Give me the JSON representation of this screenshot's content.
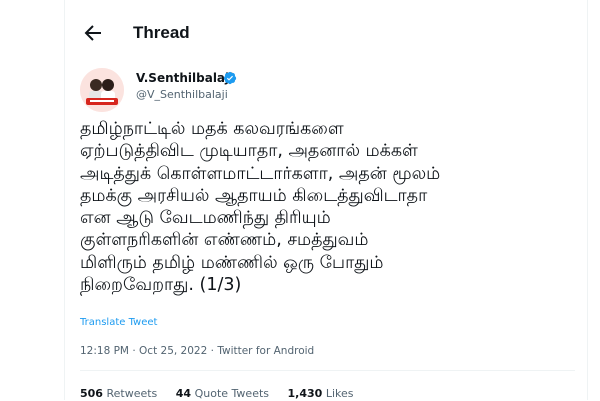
{
  "header": {
    "title": "Thread",
    "back_icon": "arrow-left-icon"
  },
  "tweet": {
    "author": {
      "name": "V.Senthilbalaji",
      "handle": "@V_Senthilbalaji",
      "verified": true,
      "verified_color": "#1d9bf0"
    },
    "text_lines": [
      "தமிழ்நாட்டில் மதக் கலவரங்களை",
      "ஏற்படுத்திவிட முடியாதா, அதனால் மக்கள்",
      "அடித்துக் கொள்ளமாட்டார்களா, அதன் மூலம்",
      "தமக்கு அரசியல் ஆதாயம் கிடைத்துவிடாதா",
      "என ஆடு வேடமணிந்து திரியும்",
      "குள்ளநரிகளின் எண்ணம், சமத்துவம்",
      "மிளிரும் தமிழ் மண்ணில் ஒரு போதும்",
      "நிறைவேறாது. (1/3)"
    ],
    "translate_label": "Translate Tweet",
    "time": "12:18 PM",
    "date": "Oct 25, 2022",
    "source": "Twitter for Android",
    "separator": "·",
    "stats": {
      "retweets": {
        "count": "506",
        "label": "Retweets"
      },
      "quotes": {
        "count": "44",
        "label": "Quote Tweets"
      },
      "likes": {
        "count": "1,430",
        "label": "Likes"
      }
    }
  },
  "colors": {
    "link": "#1d9bf0",
    "secondary_text": "#536471",
    "border": "#eff3f4"
  }
}
